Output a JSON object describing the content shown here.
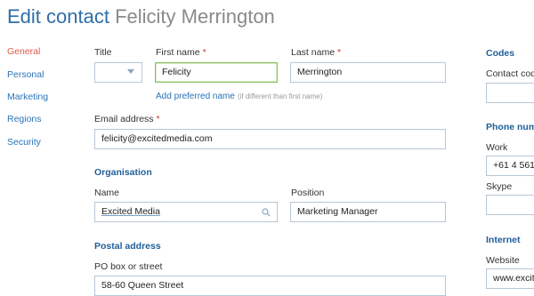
{
  "header": {
    "title_prefix": "Edit contact",
    "contact_name": "Felicity Merrington"
  },
  "sidebar": {
    "items": [
      {
        "label": "General",
        "active": true
      },
      {
        "label": "Personal"
      },
      {
        "label": "Marketing"
      },
      {
        "label": "Regions"
      },
      {
        "label": "Security"
      }
    ]
  },
  "form": {
    "title_label": "Title",
    "title_value": "",
    "first_name_label": "First name",
    "first_name_value": "Felicity",
    "last_name_label": "Last name",
    "last_name_value": "Merrington",
    "required_marker": "*",
    "add_preferred_link": "Add preferred name",
    "add_preferred_hint": "(if different than first name)",
    "email_label": "Email address",
    "email_value": "felicity@excitedmedia.com",
    "organisation_heading": "Organisation",
    "org_name_label": "Name",
    "org_name_value": "Excited Media",
    "position_label": "Position",
    "position_value": "Marketing Manager",
    "postal_heading": "Postal address",
    "po_box_label": "PO box or street",
    "po_box_value": "58-60 Queen Street"
  },
  "right_panel": {
    "codes_heading": "Codes",
    "contact_code_label": "Contact cod",
    "contact_code_value": "",
    "phone_heading": "Phone num",
    "work_label": "Work",
    "work_value": "+61 4 561",
    "skype_label": "Skype",
    "skype_value": "",
    "internet_heading": "Internet",
    "website_label": "Website",
    "website_value": "www.excite"
  },
  "colors": {
    "accent": "#2f6ea6",
    "active_nav": "#e0574a",
    "focus_border": "#8dc060",
    "section_heading": "#1f5f99"
  },
  "icons": {
    "org_search": "search-icon",
    "title_dropdown": "chevron-down-icon"
  }
}
